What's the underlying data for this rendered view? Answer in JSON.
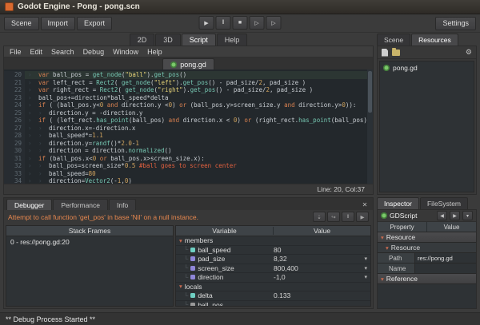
{
  "colors": {
    "logo": "#d9692f",
    "error": "#e8884f",
    "kw": "#d88050",
    "str": "#e6d378",
    "fn": "#76c7b2",
    "num": "#d0a35e",
    "com": "#e2603f",
    "txt": "#c9ced3",
    "script_icon": "#7bc96a"
  },
  "title_bar": {
    "title": "Godot Engine - Pong - pong.scn"
  },
  "toolbar": {
    "left_buttons": [
      "Scene",
      "Import",
      "Export"
    ],
    "play_controls": [
      "play",
      "pause",
      "stop",
      "play-scene",
      "play-custom"
    ],
    "settings_label": "Settings"
  },
  "workspace": {
    "tabs": [
      "2D",
      "3D",
      "Script",
      "Help"
    ],
    "active": "Script"
  },
  "script_editor": {
    "menus": [
      "File",
      "Edit",
      "Search",
      "Debug",
      "Window",
      "Help"
    ],
    "tab_label": "pong.gd",
    "status": "Line: 20, Col:37",
    "lines": [
      {
        "n": 20,
        "indent": 1,
        "current": true,
        "tokens": [
          [
            "k",
            "var"
          ],
          [
            "p",
            " ball_pos = "
          ],
          [
            "f",
            "get_node"
          ],
          [
            "p",
            "("
          ],
          [
            "s",
            "\"ball\""
          ],
          [
            "p",
            ")."
          ],
          [
            "f",
            "get_pos"
          ],
          [
            "p",
            "()"
          ]
        ]
      },
      {
        "n": 21,
        "indent": 1,
        "tokens": [
          [
            "k",
            "var"
          ],
          [
            "p",
            " left_rect = "
          ],
          [
            "f",
            "Rect2"
          ],
          [
            "p",
            "( "
          ],
          [
            "f",
            "get_node"
          ],
          [
            "p",
            "("
          ],
          [
            "s",
            "\"left\""
          ],
          [
            "p",
            ")."
          ],
          [
            "f",
            "get_pos"
          ],
          [
            "p",
            "() - pad_size/"
          ],
          [
            "n",
            "2"
          ],
          [
            "p",
            ", pad_size )"
          ]
        ]
      },
      {
        "n": 22,
        "indent": 1,
        "tokens": [
          [
            "k",
            "var"
          ],
          [
            "p",
            " right_rect = "
          ],
          [
            "f",
            "Rect2"
          ],
          [
            "p",
            "( "
          ],
          [
            "f",
            "get_node"
          ],
          [
            "p",
            "("
          ],
          [
            "s",
            "\"right\""
          ],
          [
            "p",
            ")."
          ],
          [
            "f",
            "get_pos"
          ],
          [
            "p",
            "() - pad_size/"
          ],
          [
            "n",
            "2"
          ],
          [
            "p",
            ", pad_size )"
          ]
        ]
      },
      {
        "n": 23,
        "indent": 1,
        "tokens": [
          [
            "p",
            "ball_pos+=direction*ball_speed*delta"
          ]
        ]
      },
      {
        "n": 24,
        "indent": 1,
        "tokens": [
          [
            "k",
            "if"
          ],
          [
            "p",
            " ( (ball_pos.y<"
          ],
          [
            "n",
            "0"
          ],
          [
            "p",
            " "
          ],
          [
            "k",
            "and"
          ],
          [
            "p",
            " direction.y <"
          ],
          [
            "n",
            "0"
          ],
          [
            "p",
            ") "
          ],
          [
            "k",
            "or"
          ],
          [
            "p",
            " (ball_pos.y>screen_size.y "
          ],
          [
            "k",
            "and"
          ],
          [
            "p",
            " direction.y>"
          ],
          [
            "n",
            "0"
          ],
          [
            "p",
            ")):"
          ]
        ]
      },
      {
        "n": 25,
        "indent": 2,
        "tokens": [
          [
            "p",
            "direction.y = -direction.y"
          ]
        ]
      },
      {
        "n": 26,
        "indent": 1,
        "tokens": [
          [
            "k",
            "if"
          ],
          [
            "p",
            " ( (left_rect."
          ],
          [
            "f",
            "has_point"
          ],
          [
            "p",
            "(ball_pos) "
          ],
          [
            "k",
            "and"
          ],
          [
            "p",
            " direction.x < "
          ],
          [
            "n",
            "0"
          ],
          [
            "p",
            ") "
          ],
          [
            "k",
            "or"
          ],
          [
            "p",
            " (right_rect."
          ],
          [
            "f",
            "has_point"
          ],
          [
            "p",
            "(ball_pos) "
          ],
          [
            "k",
            "and"
          ],
          [
            "p",
            " dir"
          ]
        ]
      },
      {
        "n": 27,
        "indent": 2,
        "tokens": [
          [
            "p",
            "direction.x=-direction.x"
          ]
        ]
      },
      {
        "n": 28,
        "indent": 2,
        "tokens": [
          [
            "p",
            "ball_speed*="
          ],
          [
            "n",
            "1.1"
          ]
        ]
      },
      {
        "n": 29,
        "indent": 2,
        "tokens": [
          [
            "p",
            "direction.y="
          ],
          [
            "f",
            "randf"
          ],
          [
            "p",
            "()*"
          ],
          [
            "n",
            "2.0"
          ],
          [
            "p",
            "-"
          ],
          [
            "n",
            "1"
          ]
        ]
      },
      {
        "n": 30,
        "indent": 2,
        "tokens": [
          [
            "p",
            "direction = direction."
          ],
          [
            "f",
            "normalized"
          ],
          [
            "p",
            "()"
          ]
        ]
      },
      {
        "n": 31,
        "indent": 1,
        "tokens": [
          [
            "k",
            "if"
          ],
          [
            "p",
            " (ball_pos.x<"
          ],
          [
            "n",
            "0"
          ],
          [
            "p",
            " "
          ],
          [
            "k",
            "or"
          ],
          [
            "p",
            " ball_pos.x>screen_size.x):"
          ]
        ]
      },
      {
        "n": 32,
        "indent": 2,
        "tokens": [
          [
            "p",
            "ball_pos=screen_size*"
          ],
          [
            "n",
            "0.5"
          ],
          [
            "p",
            " "
          ],
          [
            "c",
            "#ball goes to screen center"
          ]
        ]
      },
      {
        "n": 33,
        "indent": 2,
        "tokens": [
          [
            "p",
            "ball_speed="
          ],
          [
            "n",
            "80"
          ]
        ]
      },
      {
        "n": 34,
        "indent": 2,
        "tokens": [
          [
            "p",
            "direction="
          ],
          [
            "f",
            "Vector2"
          ],
          [
            "p",
            "(-"
          ],
          [
            "n",
            "1"
          ],
          [
            "p",
            ","
          ],
          [
            "n",
            "0"
          ],
          [
            "p",
            ")"
          ]
        ]
      }
    ]
  },
  "debugger": {
    "tabs": [
      "Debugger",
      "Performance",
      "Info"
    ],
    "active": "Debugger",
    "error": "Attempt to call function 'get_pos' in base 'Nil' on a null instance.",
    "buttons": [
      "step-into",
      "step-over",
      "break",
      "continue"
    ],
    "stack_frames": {
      "header": "Stack Frames",
      "rows": [
        "0 - res://pong.gd:20"
      ]
    },
    "variables": {
      "col_headers": [
        "Variable",
        "Value"
      ],
      "type_icon_colors": {
        "float": "#6fd0c3",
        "vec2": "#8f86d8",
        "nil": "#9a9a9a"
      },
      "groups": [
        {
          "name": "members",
          "rows": [
            {
              "name": "ball_speed",
              "type": "float",
              "value": "80"
            },
            {
              "name": "pad_size",
              "type": "vec2",
              "value": "8,32",
              "expand": true
            },
            {
              "name": "screen_size",
              "type": "vec2",
              "value": "800,400",
              "expand": true
            },
            {
              "name": "direction",
              "type": "vec2",
              "value": "-1,0",
              "expand": true
            }
          ]
        },
        {
          "name": "locals",
          "rows": [
            {
              "name": "delta",
              "type": "float",
              "value": "0.133"
            },
            {
              "name": "ball_pos",
              "type": "nil",
              "value": ""
            }
          ]
        }
      ]
    }
  },
  "right_dock": {
    "top_tabs": [
      "Scene",
      "Resources"
    ],
    "top_active": "Resources",
    "resources": {
      "items": [
        "pong.gd"
      ]
    },
    "bottom_tabs": [
      "Inspector",
      "FileSystem"
    ],
    "bottom_active": "Inspector"
  },
  "inspector": {
    "object_name": "GDScript",
    "col_headers": [
      "Property",
      "Value"
    ],
    "rows": [
      {
        "kind": "category",
        "label": "Resource"
      },
      {
        "kind": "group",
        "label": "Resource"
      },
      {
        "kind": "prop",
        "label": "Path",
        "value": "res://pong.gd"
      },
      {
        "kind": "prop",
        "label": "Name",
        "value": ""
      },
      {
        "kind": "category",
        "label": "Reference"
      }
    ]
  },
  "status_bar": {
    "text": "** Debug Process Started **"
  }
}
